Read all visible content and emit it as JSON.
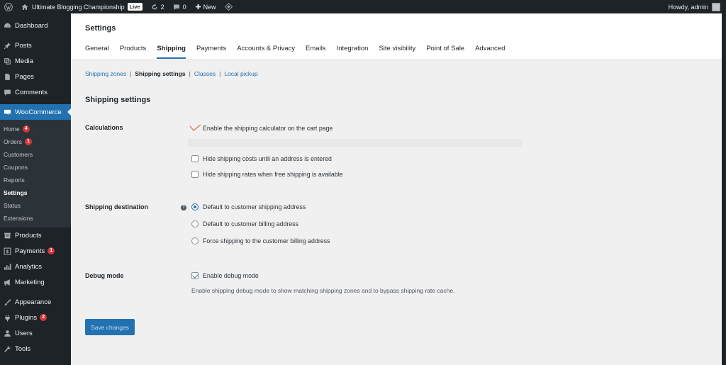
{
  "adminbar": {
    "site_name": "Ultimate Blogging Championship",
    "live_label": "Live",
    "updates_count": "2",
    "comments_count": "0",
    "new_label": "New",
    "howdy": "Howdy, admin"
  },
  "sidebar": {
    "dashboard": "Dashboard",
    "posts": "Posts",
    "media": "Media",
    "pages": "Pages",
    "comments": "Comments",
    "woocommerce": "WooCommerce",
    "woo_sub": {
      "home": "Home",
      "home_badge": "4",
      "orders": "Orders",
      "orders_badge": "1",
      "customers": "Customers",
      "coupons": "Coupons",
      "reports": "Reports",
      "settings": "Settings",
      "status": "Status",
      "extensions": "Extensions"
    },
    "products": "Products",
    "payments": "Payments",
    "payments_badge": "1",
    "analytics": "Analytics",
    "marketing": "Marketing",
    "appearance": "Appearance",
    "plugins": "Plugins",
    "plugins_badge": "2",
    "users": "Users",
    "tools": "Tools"
  },
  "header": {
    "title": "Settings",
    "tabs": [
      "General",
      "Products",
      "Shipping",
      "Payments",
      "Accounts & Privacy",
      "Emails",
      "Integration",
      "Site visibility",
      "Point of Sale",
      "Advanced"
    ],
    "active_tab": "Shipping"
  },
  "subnav": {
    "zones": "Shipping zones",
    "settings": "Shipping settings",
    "classes": "Classes",
    "local_pickup": "Local pickup",
    "separator": "|"
  },
  "form": {
    "section_title": "Shipping settings",
    "calculations_label": "Calculations",
    "calc_options": [
      {
        "label": "Enable the shipping calculator on the cart page",
        "checked": true
      },
      {
        "label": "Hide shipping costs until an address is entered",
        "checked": false
      },
      {
        "label": "Hide shipping rates when free shipping is available",
        "checked": false
      }
    ],
    "destination_label": "Shipping destination",
    "help_glyph": "?",
    "destination_options": [
      {
        "label": "Default to customer shipping address",
        "checked": true
      },
      {
        "label": "Default to customer billing address",
        "checked": false
      },
      {
        "label": "Force shipping to the customer billing address",
        "checked": false
      }
    ],
    "debug_label": "Debug mode",
    "debug_option": "Enable debug mode",
    "debug_description": "Enable shipping debug mode to show matching shipping zones and to bypass shipping rate cache.",
    "save_button": "Save changes"
  },
  "colors": {
    "accent": "#2271b1",
    "checkmark_highlight": "#e26f56",
    "badge": "#d63638"
  }
}
